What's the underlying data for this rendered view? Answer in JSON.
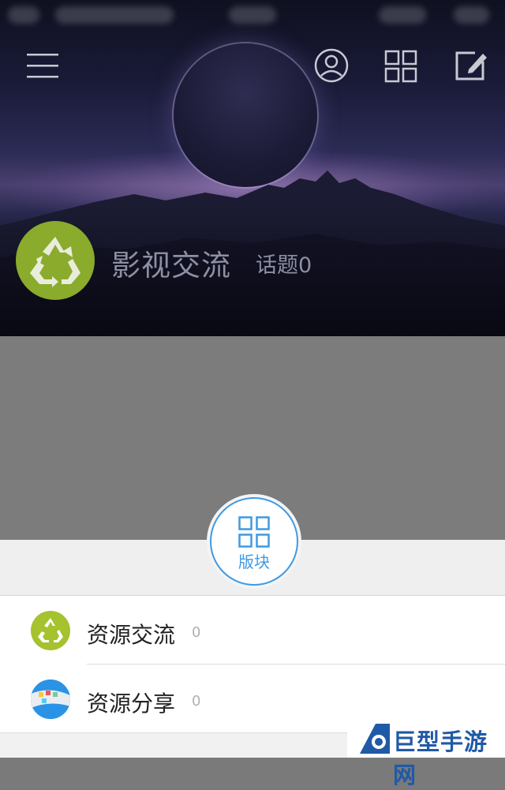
{
  "header": {
    "menu_icon": "menu-icon",
    "profile_icon": "user-circle-icon",
    "grid_icon": "grid-icon",
    "edit_icon": "edit-icon"
  },
  "forum": {
    "title": "影视交流",
    "topics": "话题0",
    "avatar_icon": "recycle-icon",
    "avatar_color": "#8bab2c"
  },
  "board_button": {
    "label": "版块",
    "icon": "grid-icon",
    "accent": "#3f9ae3"
  },
  "boards": [
    {
      "name": "资源交流",
      "count": "0",
      "icon": "recycle-icon"
    },
    {
      "name": "资源分享",
      "count": "0",
      "icon": "ios-icon"
    }
  ],
  "watermark": {
    "text": "巨型手游网"
  }
}
